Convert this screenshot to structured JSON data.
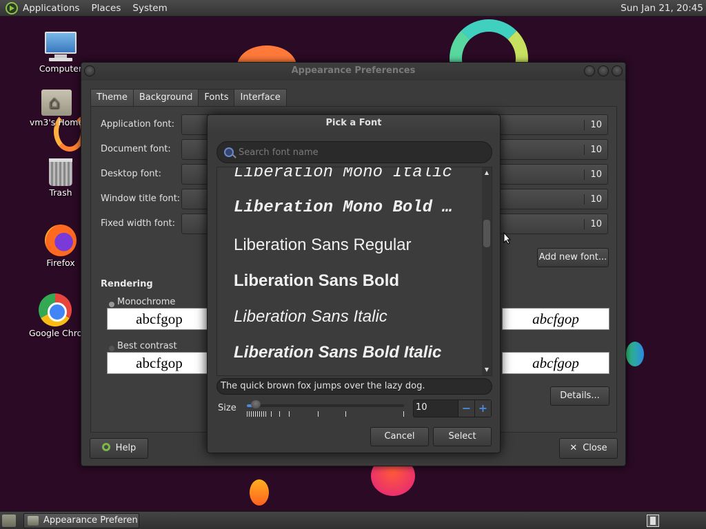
{
  "top_panel": {
    "menus": [
      "Applications",
      "Places",
      "System"
    ],
    "clock": "Sun Jan 21, 20:45"
  },
  "desktop_icons": [
    {
      "label": "Computer",
      "icon": "computer-icon"
    },
    {
      "label": "vm3's Home",
      "icon": "home-folder-icon"
    },
    {
      "label": "Trash",
      "icon": "trash-icon"
    },
    {
      "label": "Firefox",
      "icon": "firefox-icon"
    },
    {
      "label": "Google Chrome",
      "icon": "chrome-icon"
    }
  ],
  "main_window": {
    "title": "Appearance Preferences",
    "tabs": [
      "Theme",
      "Background",
      "Fonts",
      "Interface"
    ],
    "active_tab": "Fonts",
    "font_rows": [
      {
        "label": "Application font:",
        "size": "10"
      },
      {
        "label": "Document font:",
        "size": "10"
      },
      {
        "label": "Desktop font:",
        "size": "10"
      },
      {
        "label": "Window title font:",
        "size": "10"
      },
      {
        "label": "Fixed width font:",
        "size": "10"
      }
    ],
    "add_font_label": "Add new font...",
    "rendering_title": "Rendering",
    "rendering_options": [
      {
        "label": "Monochrome",
        "sample": "abcfgop"
      },
      {
        "label": "Best contrast",
        "sample": "abcfgop"
      }
    ],
    "right_sample": "abcfgop",
    "details_label": "Details...",
    "help_label": "Help",
    "close_label": "Close"
  },
  "dialog": {
    "title": "Pick a Font",
    "search_placeholder": "Search font name",
    "fonts": [
      "Liberation Mono Italic",
      "Liberation Mono Bold …",
      "Liberation Sans Regular",
      "Liberation Sans Bold",
      "Liberation Sans Italic",
      "Liberation Sans Bold Italic"
    ],
    "preview_text": "The quick brown fox jumps over the lazy dog.",
    "size_label": "Size",
    "size_value": "10",
    "minus": "−",
    "plus": "+",
    "cancel_label": "Cancel",
    "select_label": "Select"
  },
  "taskbar": {
    "task_label": "Appearance Preferen..."
  }
}
